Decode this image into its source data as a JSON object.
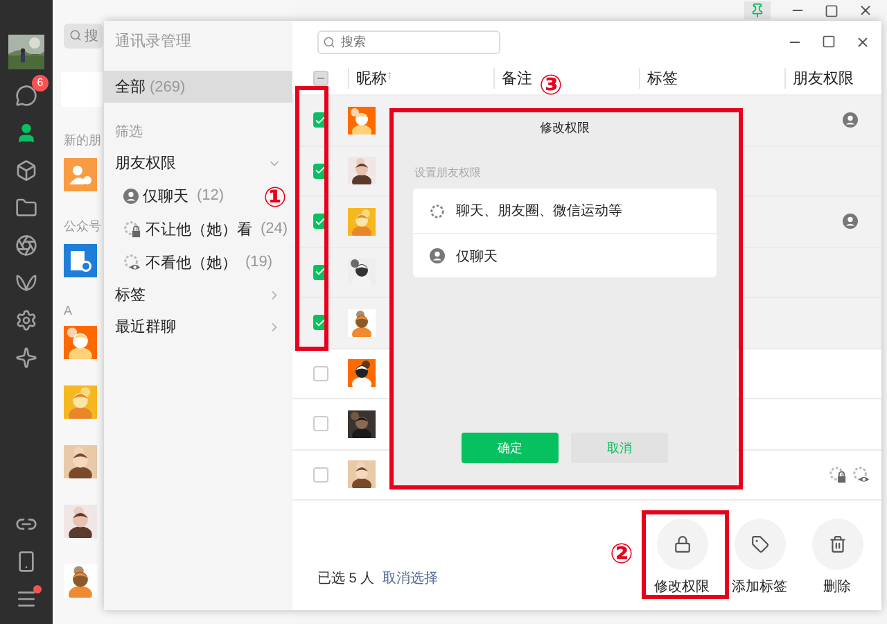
{
  "sidebar": {
    "chat_badge": "6",
    "menu_dot": true
  },
  "contact_list": {
    "search_placeholder": "搜",
    "sections": [
      "新的朋",
      "公众号",
      "A"
    ]
  },
  "manager": {
    "title": "通讯录管理",
    "all": {
      "label": "全部",
      "count": "(269)",
      "selected": true
    },
    "filter_heading": "筛选",
    "groups": [
      {
        "label": "朋友权限",
        "expanded": true,
        "children": [
          {
            "label": "仅聊天",
            "count": "(12)",
            "kind": "chat_only"
          },
          {
            "label": "不让他（她）看",
            "count": "(24)",
            "kind": "hide_mine"
          },
          {
            "label": "不看他（她）",
            "count": "(19)",
            "kind": "hide_theirs"
          }
        ]
      },
      {
        "label": "标签",
        "expanded": false
      },
      {
        "label": "最近群聊",
        "expanded": false
      }
    ],
    "search_placeholder": "搜索",
    "header_checkbox_partial": true,
    "columns": [
      {
        "label": "昵称",
        "sort_mark": "↑"
      },
      {
        "label": "备注"
      },
      {
        "label": "标签"
      },
      {
        "label": "朋友权限"
      }
    ],
    "rows": [
      {
        "checked": true,
        "chat_only": true,
        "restricted": false
      },
      {
        "checked": true,
        "chat_only": false,
        "restricted": false
      },
      {
        "checked": true,
        "chat_only": true,
        "restricted": false
      },
      {
        "checked": true,
        "chat_only": false,
        "restricted": false
      },
      {
        "checked": true,
        "chat_only": false,
        "restricted": false
      },
      {
        "checked": false,
        "chat_only": false,
        "restricted": false
      },
      {
        "checked": false,
        "chat_only": false,
        "restricted": false
      },
      {
        "checked": false,
        "chat_only": false,
        "restricted": true
      }
    ],
    "selection": {
      "text": "已选 5 人",
      "clear_link": "取消选择"
    },
    "actions": [
      {
        "label": "修改权限",
        "kind": "lock"
      },
      {
        "label": "添加标签",
        "kind": "tag"
      },
      {
        "label": "删除",
        "kind": "trash"
      }
    ]
  },
  "dialog": {
    "title": "修改权限",
    "subtitle": "设置朋友权限",
    "options": [
      {
        "label": "聊天、朋友圈、微信运动等",
        "kind": "all"
      },
      {
        "label": "仅聊天",
        "kind": "chat_only"
      }
    ],
    "buttons": [
      {
        "label": "确定",
        "kind": "primary"
      },
      {
        "label": "取消",
        "kind": "secondary"
      }
    ]
  },
  "annotations": [
    {
      "label": "①"
    },
    {
      "label": "③"
    },
    {
      "label": "②"
    }
  ]
}
